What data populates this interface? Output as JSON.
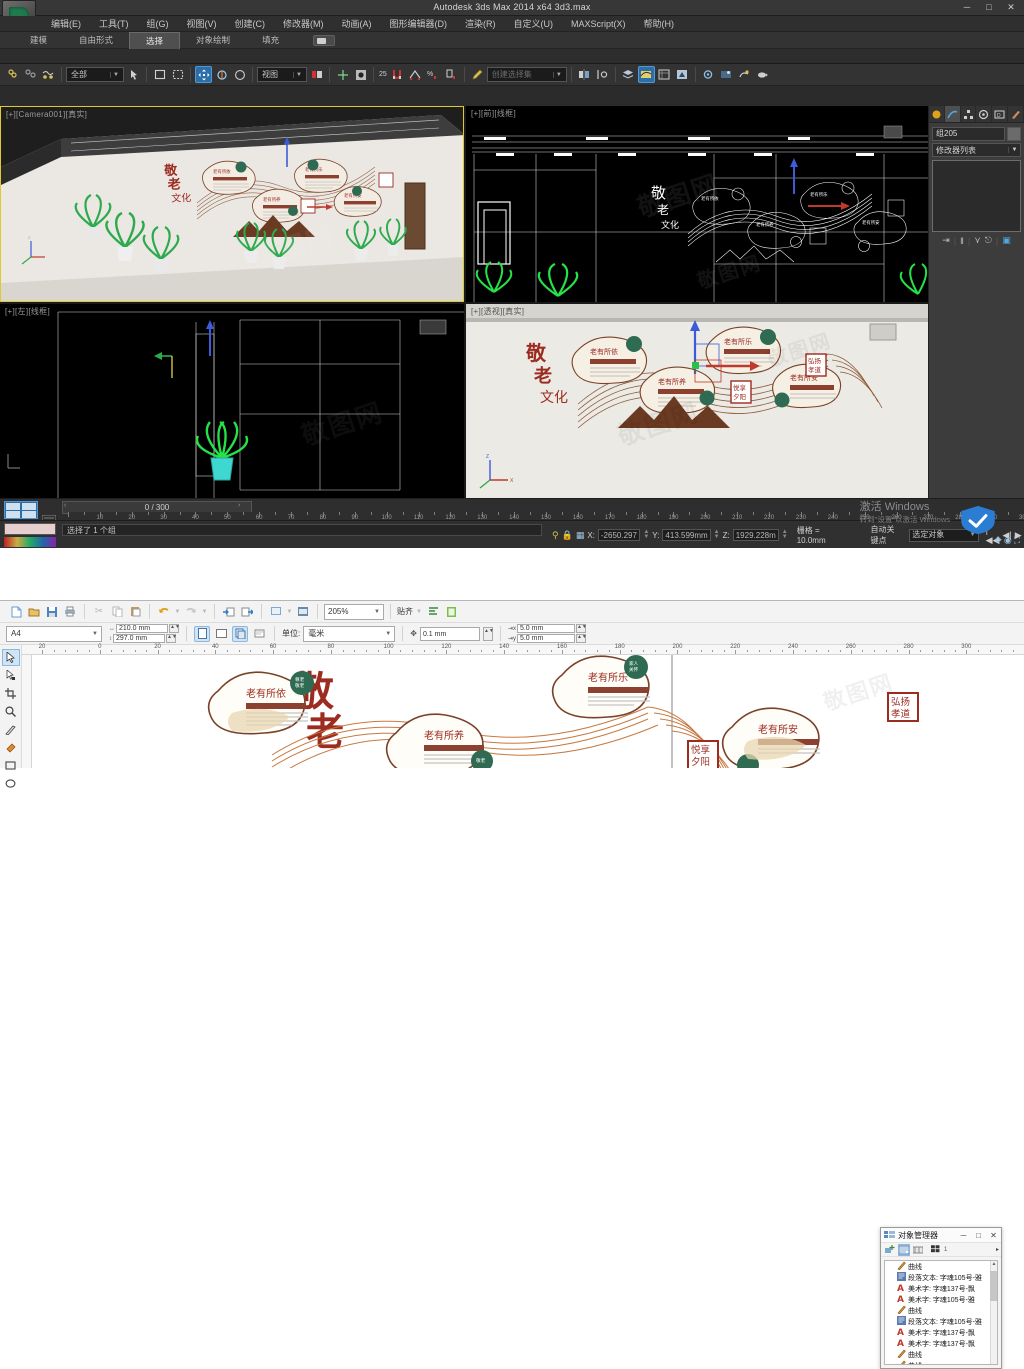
{
  "max": {
    "title": "Autodesk 3ds Max  2014 x64    3d3.max",
    "window_buttons": {
      "minimize": "─",
      "maximize": "□",
      "close": "✕"
    },
    "menu": [
      "编辑(E)",
      "工具(T)",
      "组(G)",
      "视图(V)",
      "创建(C)",
      "修改器(M)",
      "动画(A)",
      "图形编辑器(D)",
      "渲染(R)",
      "自定义(U)",
      "MAXScript(X)",
      "帮助(H)"
    ],
    "ribbon_tabs": [
      {
        "label": "建模",
        "active": false
      },
      {
        "label": "自由形式",
        "active": false
      },
      {
        "label": "选择",
        "active": true
      },
      {
        "label": "对象绘制",
        "active": false
      },
      {
        "label": "填充",
        "active": false
      }
    ],
    "toolbar": {
      "selection_filter": "全部",
      "reference_coord": "视图",
      "named_selection": "创建选择集",
      "snap_percent": "25",
      "icons": [
        "undo-icon",
        "redo-icon",
        "select-link-icon",
        "unlink-icon",
        "bind-space-warp-icon",
        "select-object-icon",
        "select-region-icon",
        "window-crossing-icon",
        "select-move-icon",
        "select-rotate-icon",
        "select-scale-icon",
        "mirror-icon",
        "align-icon",
        "layer-manager-icon",
        "curve-editor-icon",
        "schematic-view-icon",
        "material-editor-icon",
        "render-setup-icon",
        "render-frame-icon",
        "render-production-icon"
      ]
    },
    "viewports": [
      {
        "label": "[+][Camera001][真实]",
        "active": true
      },
      {
        "label": "[+][前][线框]",
        "active": false
      },
      {
        "label": "[+][左][线框]",
        "active": false
      },
      {
        "label": "[+][透视][真实]",
        "active": false
      }
    ],
    "command_panel": {
      "tabs": [
        "create-tab-icon",
        "modify-tab-icon",
        "hierarchy-tab-icon",
        "motion-tab-icon",
        "display-tab-icon",
        "utilities-tab-icon"
      ],
      "object_name": "组205",
      "modifier_list": "修改器列表",
      "stack_buttons": [
        "pin-stack-icon",
        "show-end-result-icon",
        "make-unique-icon",
        "remove-modifier-icon",
        "configure-sets-icon"
      ]
    },
    "timeline": {
      "frame_display": "0 / 300",
      "prev_arrow": "‹",
      "next_arrow": "›",
      "tick_labels": [
        10,
        20,
        30,
        40,
        50,
        60,
        70,
        80,
        90,
        100,
        110,
        120,
        130,
        140,
        150,
        160,
        170,
        180,
        190,
        200,
        210,
        220,
        230,
        240,
        250,
        260,
        270,
        280,
        290,
        300
      ]
    },
    "status": {
      "prompt": "选择了 1 个组",
      "x_label": "X:",
      "x_value": "-2650.297",
      "y_label": "Y:",
      "y_value": "413.599mm",
      "z_label": "Z:",
      "z_value": "1929.228m",
      "grid": "栅格 = 10.0mm",
      "auto_key": "自动关键点",
      "selection_mode": "选定对象",
      "lock_icon": "lock-icon",
      "key_filter_icon": "key-filters-icon"
    },
    "windows_activation": {
      "line1": "激活 Windows",
      "line2": "转到\"设置\"以激活 Windows"
    },
    "artwork": {
      "main_title": "敬老文化",
      "panels": [
        "老有所依",
        "老有所乐",
        "老有所养",
        "老有所安"
      ],
      "badges": [
        "弘扬孝道",
        "悦享夕阳"
      ],
      "circles": [
        "尊老\n敬老",
        "家人\n关怀",
        "敬老",
        "关爱"
      ]
    }
  },
  "corel": {
    "toolbar": {
      "zoom_level": "205%",
      "snap_label": "贴齐",
      "icons": [
        "new-icon",
        "open-icon",
        "save-icon",
        "print-icon",
        "cut-icon",
        "copy-icon",
        "paste-icon",
        "undo-icon",
        "redo-icon",
        "import-icon",
        "export-icon",
        "publish-pdf-icon",
        "application-launcher-icon",
        "snap-icon",
        "options-icon",
        "corel-connect-icon"
      ]
    },
    "property_bar": {
      "page_size": "A4",
      "page_width": "210.0 mm",
      "page_height": "297.0 mm",
      "orientation_portrait_icon": "portrait-icon",
      "orientation_landscape_icon": "landscape-icon",
      "all_pages_icon": "all-pages-icon",
      "current_page_icon": "current-page-icon",
      "unit_label": "单位:",
      "unit_value": "毫米",
      "nudge_value": "0.1 mm",
      "duplicate_x": "5.0 mm",
      "duplicate_y": "5.0 mm"
    },
    "toolbox": [
      "pick-tool-icon",
      "shape-tool-icon",
      "crop-tool-icon",
      "zoom-tool-icon",
      "freehand-tool-icon",
      "smart-fill-tool-icon",
      "rectangle-tool-icon",
      "ellipse-tool-icon"
    ],
    "ruler_h_labels": [
      20,
      0,
      20,
      40,
      60,
      80,
      100,
      120,
      140,
      160,
      180,
      200,
      220,
      240,
      260,
      280,
      300
    ],
    "object_manager": {
      "title": "对象管理器",
      "minimize": "─",
      "maximize": "□",
      "close": "✕",
      "tool_icons": [
        "new-layer-icon",
        "layer-manager-view-icon",
        "edit-across-layers-icon",
        "new-master-layer-icon"
      ],
      "items": [
        {
          "icon": "curve-icon",
          "label": "曲线"
        },
        {
          "icon": "paragraph-text-icon",
          "label": "段落文本: 字魂105号-雅"
        },
        {
          "icon": "artistic-text-icon",
          "label": "美术字: 字魂137号-飘"
        },
        {
          "icon": "artistic-text-icon",
          "label": "美术字: 字魂105号-雅"
        },
        {
          "icon": "curve-icon",
          "label": "曲线"
        },
        {
          "icon": "paragraph-text-icon",
          "label": "段落文本: 字魂105号-雅"
        },
        {
          "icon": "artistic-text-icon",
          "label": "美术字: 字魂137号-飘"
        },
        {
          "icon": "artistic-text-icon",
          "label": "美术字: 字魂137号-飘"
        },
        {
          "icon": "curve-icon",
          "label": "曲线"
        },
        {
          "icon": "curve-icon",
          "label": "曲线"
        }
      ]
    },
    "artwork": {
      "main_title": "敬老",
      "panels": [
        "老有所依",
        "老有所乐",
        "老有所养",
        "老有所安"
      ],
      "badges": [
        "弘扬孝道",
        "悦享夕阳"
      ]
    }
  },
  "colors": {
    "max_bg": "#2b2b2b",
    "accent_yellow": "#e0c830",
    "accent_blue": "#2c6ea8",
    "art_red": "#9c2b20",
    "art_brown": "#7a4228",
    "art_green": "#2f6b52"
  }
}
